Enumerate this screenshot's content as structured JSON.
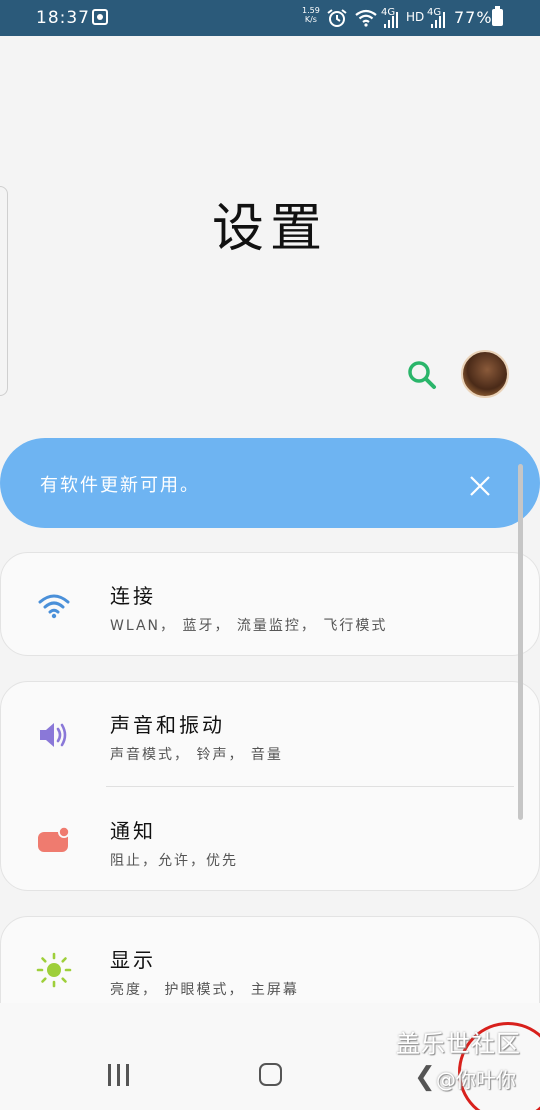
{
  "status_bar": {
    "time": "18:37",
    "speed_value": "1.59",
    "speed_unit": "K/s",
    "network1": "4G",
    "hd": "HD",
    "network2": "4G",
    "battery_percent": "77%"
  },
  "header": {
    "title": "设置"
  },
  "banner": {
    "text": "有软件更新可用。"
  },
  "settings": [
    {
      "title": "连接",
      "subtitle": "WLAN， 蓝牙， 流量监控， 飞行模式",
      "icon": "wifi-icon",
      "color": "#4a90d9"
    },
    {
      "title": "声音和振动",
      "subtitle": "声音模式， 铃声， 音量",
      "icon": "speaker-icon",
      "color": "#8a78d8"
    },
    {
      "title": "通知",
      "subtitle": "阻止，允许，优先",
      "icon": "notification-icon",
      "color": "#ef7b6f"
    },
    {
      "title": "显示",
      "subtitle": "亮度， 护眼模式， 主屏幕",
      "icon": "sun-icon",
      "color": "#9ecf3a"
    }
  ],
  "watermark": {
    "title": "盖乐世社区",
    "sub": "@你叶你"
  },
  "colors": {
    "status_bar": "#2b5a7a",
    "banner": "#6eb4f2",
    "search": "#2ab56a"
  }
}
